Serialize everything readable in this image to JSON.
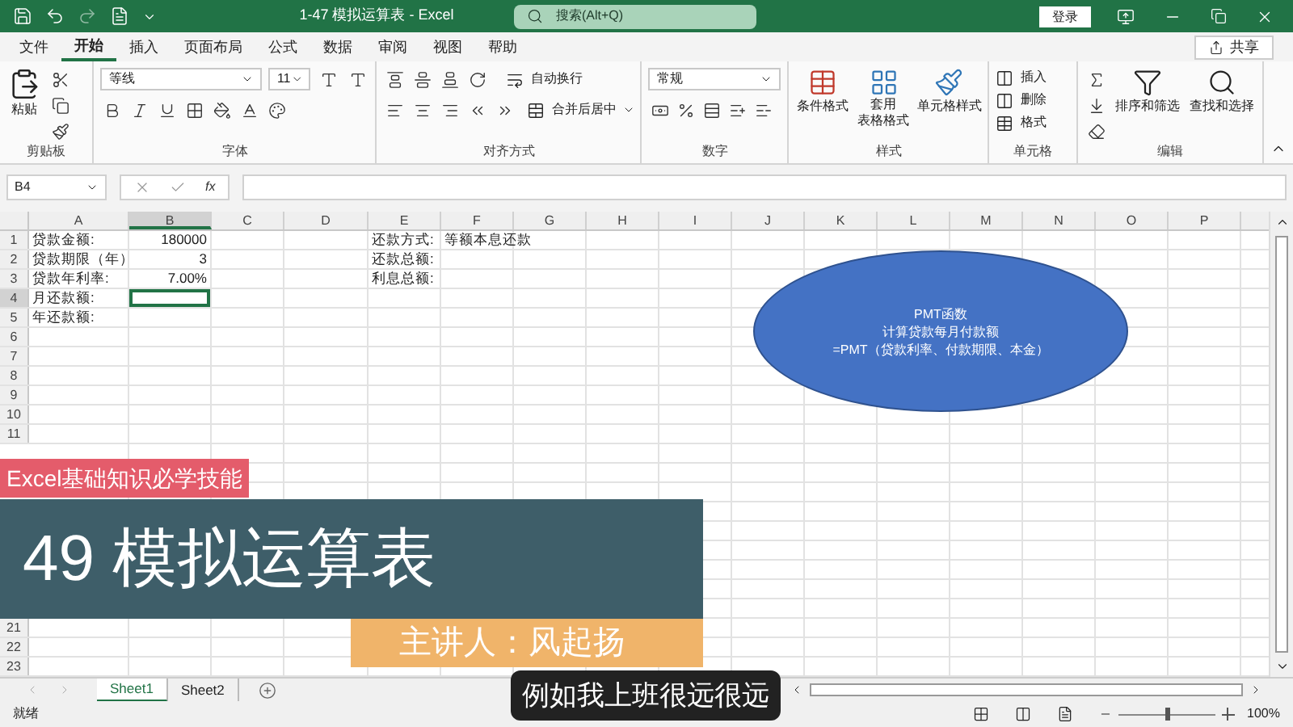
{
  "window": {
    "title": "1-47 模拟运算表  -  Excel",
    "search_placeholder": "搜索(Alt+Q)",
    "sign_in": "登录"
  },
  "menu_tabs": [
    {
      "label": "文件",
      "selected": false
    },
    {
      "label": "开始",
      "selected": true
    },
    {
      "label": "插入",
      "selected": false
    },
    {
      "label": "页面布局",
      "selected": false
    },
    {
      "label": "公式",
      "selected": false
    },
    {
      "label": "数据",
      "selected": false
    },
    {
      "label": "审阅",
      "selected": false
    },
    {
      "label": "视图",
      "selected": false
    },
    {
      "label": "帮助",
      "selected": false
    }
  ],
  "share": "共享",
  "ribbon": {
    "clipboard": {
      "label": "剪贴板",
      "paste": "粘贴"
    },
    "font": {
      "label": "字体",
      "name": "等线",
      "size": "11"
    },
    "alignment": {
      "label": "对齐方式",
      "wrap": "自动换行",
      "merge": "合并后居中"
    },
    "number": {
      "label": "数字",
      "format": "常规"
    },
    "styles": {
      "label": "样式",
      "conditional": "条件格式",
      "table_format": [
        "套用",
        "表格格式"
      ],
      "cell_style": "单元格样式"
    },
    "cells": {
      "label": "单元格",
      "insert": "插入",
      "delete": "删除",
      "format": "格式"
    },
    "editing": {
      "label": "编辑",
      "sort": "排序和筛选",
      "find": "查找和选择"
    }
  },
  "formula_bar": {
    "name_box": "B4",
    "function_label": "fx"
  },
  "columns": [
    {
      "label": "A",
      "selected": false
    },
    {
      "label": "B",
      "selected": true
    },
    {
      "label": "C",
      "selected": false
    },
    {
      "label": "D",
      "selected": false
    },
    {
      "label": "E",
      "selected": false
    },
    {
      "label": "F",
      "selected": false
    },
    {
      "label": "G",
      "selected": false
    },
    {
      "label": "H",
      "selected": false
    },
    {
      "label": "I",
      "selected": false
    },
    {
      "label": "J",
      "selected": false
    },
    {
      "label": "K",
      "selected": false
    },
    {
      "label": "L",
      "selected": false
    },
    {
      "label": "M",
      "selected": false
    },
    {
      "label": "N",
      "selected": false
    },
    {
      "label": "O",
      "selected": false
    },
    {
      "label": "P",
      "selected": false
    }
  ],
  "rows": [
    {
      "number": "1",
      "selected": false,
      "cells": {
        "A": {
          "text": "贷款金额:",
          "kind": "text",
          "selected": false
        },
        "B": {
          "text": "180000",
          "kind": "number",
          "selected": false
        },
        "E": {
          "text": "还款方式:",
          "kind": "text",
          "selected": false
        },
        "F": {
          "text": "等额本息还款",
          "kind": "text",
          "selected": false
        }
      }
    },
    {
      "number": "2",
      "selected": false,
      "cells": {
        "A": {
          "text": "贷款期限（年）",
          "kind": "text",
          "selected": false
        },
        "B": {
          "text": "3",
          "kind": "number",
          "selected": false
        },
        "E": {
          "text": "还款总额:",
          "kind": "text",
          "selected": false
        }
      }
    },
    {
      "number": "3",
      "selected": false,
      "cells": {
        "A": {
          "text": "贷款年利率:",
          "kind": "text",
          "selected": false
        },
        "B": {
          "text": "7.00%",
          "kind": "number",
          "selected": false
        },
        "E": {
          "text": "利息总额:",
          "kind": "text",
          "selected": false
        }
      }
    },
    {
      "number": "4",
      "selected": true,
      "cells": {
        "A": {
          "text": "月还款额:",
          "kind": "text",
          "selected": false
        },
        "B": {
          "kind": "number",
          "selected": true
        }
      }
    },
    {
      "number": "5",
      "selected": false,
      "cells": {
        "A": {
          "text": "年还款额:",
          "kind": "text",
          "selected": false
        }
      }
    },
    {
      "number": "6",
      "selected": false
    },
    {
      "number": "7",
      "selected": false
    },
    {
      "number": "8",
      "selected": false
    },
    {
      "number": "9",
      "selected": false
    },
    {
      "number": "10",
      "selected": false
    },
    {
      "number": "11",
      "selected": false
    },
    {
      "number": "21",
      "selected": false
    },
    {
      "number": "22",
      "selected": false
    },
    {
      "number": "23",
      "selected": false
    }
  ],
  "shape": {
    "lines": [
      "PMT函数",
      "计算贷款每月付款额",
      "=PMT（贷款利率、付款期限、本金）"
    ]
  },
  "video_overlay": {
    "tag": "Excel基础知识必学技能",
    "title": "49 模拟运算表",
    "presenter": "主讲人：风起扬",
    "subtitle": "例如我上班很远很远"
  },
  "sheet_tabs": [
    {
      "label": "Sheet1",
      "selected": true
    },
    {
      "label": "Sheet2",
      "selected": false
    }
  ],
  "status_bar": {
    "text": "就绪",
    "zoom": {
      "level": 0.5,
      "reading": "100%"
    }
  }
}
